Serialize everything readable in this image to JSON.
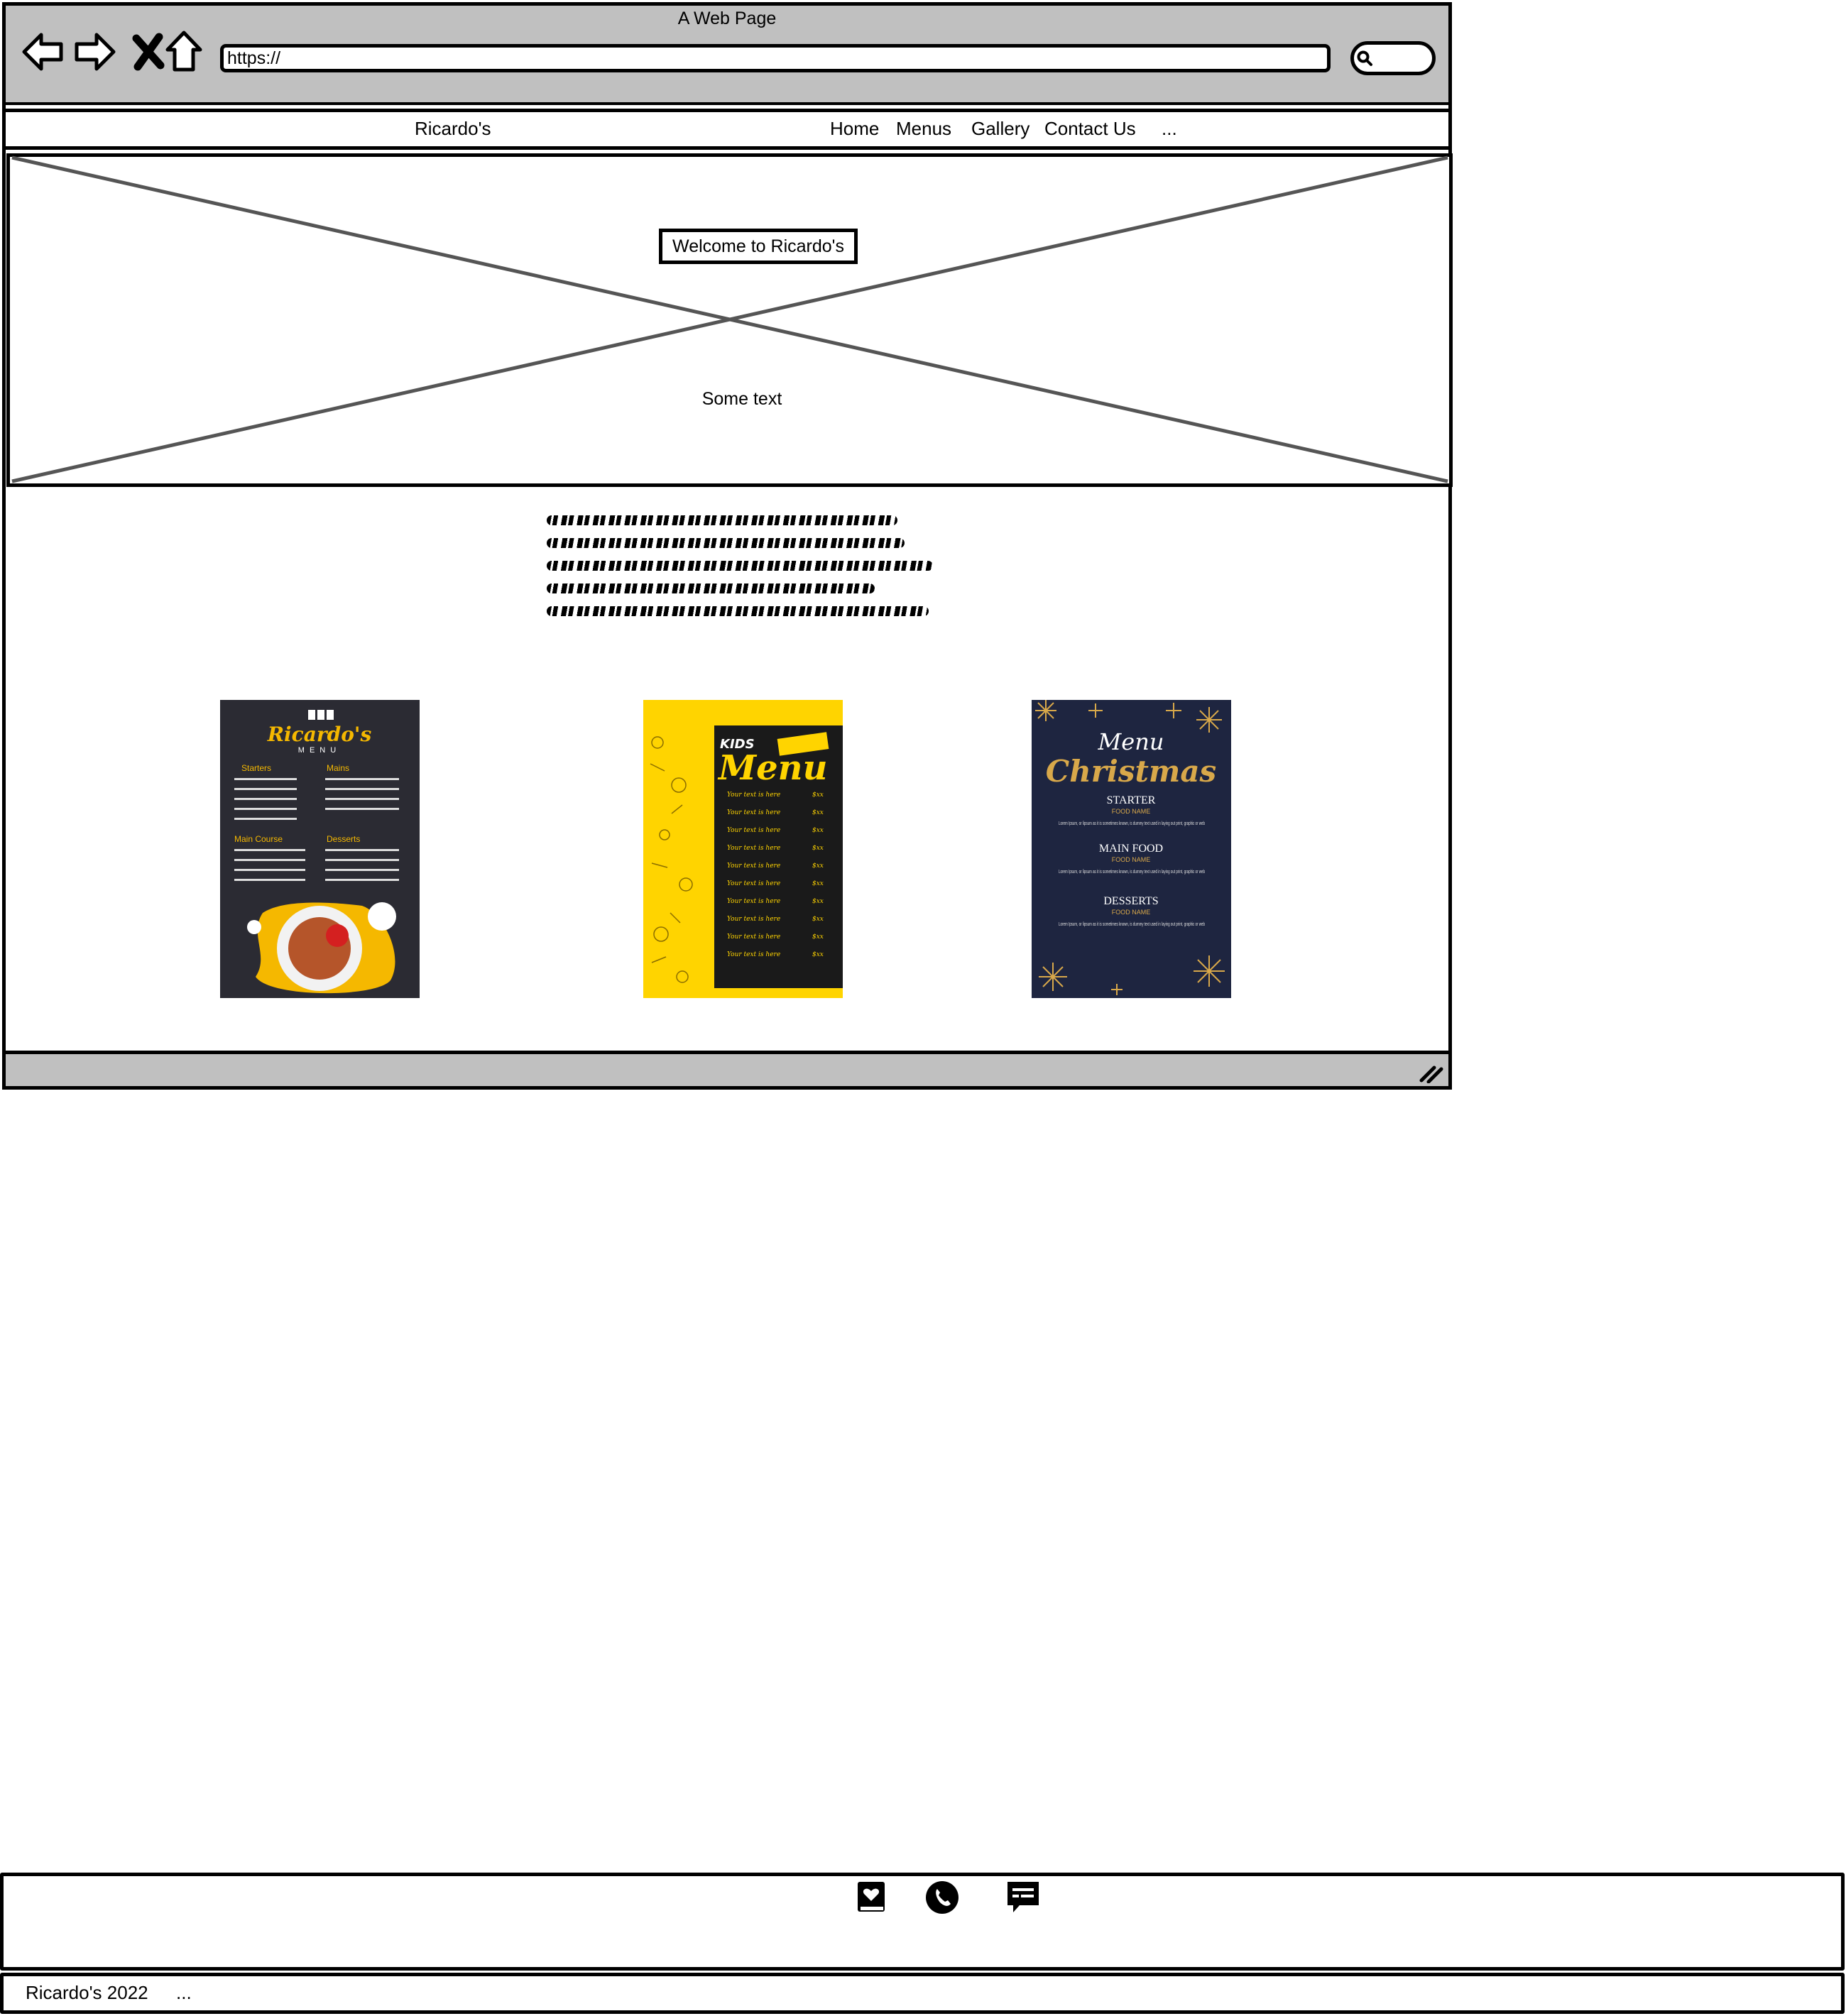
{
  "browser": {
    "title": "A Web Page",
    "url": "https://",
    "icons": [
      "back-arrow-icon",
      "forward-arrow-icon",
      "close-icon",
      "home-icon",
      "search-icon"
    ]
  },
  "nav": {
    "brand": "Ricardo's",
    "links": [
      "Home",
      "Menus",
      "Gallery",
      "Contact Us",
      "..."
    ]
  },
  "hero": {
    "title": "Welcome to Ricardo's",
    "subtitle": "Some text"
  },
  "menus": [
    {
      "name": "main-menu",
      "brand": "Ricardo's",
      "caption": "MENU",
      "sections": [
        "Starters",
        "Mains",
        "Main Course",
        "Desserts"
      ],
      "accent": "#f5b800",
      "background": "#2b2b33"
    },
    {
      "name": "kids-menu",
      "kicker": "KIDS",
      "title": "Menu",
      "line_text": "Your text is here",
      "line_price": "$xx",
      "accent": "#ffd400",
      "background": "#1a1a1a"
    },
    {
      "name": "christmas-menu",
      "kicker": "Menu",
      "title": "Christmas",
      "sections": [
        "STARTER",
        "MAIN FOOD",
        "DESSERTS"
      ],
      "item_label": "FOOD NAME",
      "body": "Lorem Ipsum, or lipsum as it is sometimes known, is dummy text used in laying out print, graphic or web",
      "accent": "#d8a84a",
      "background": "#1e2540"
    }
  ],
  "footer": {
    "icons": [
      "book-heart-icon",
      "phone-icon",
      "chat-icon"
    ],
    "copyright": "Ricardo's 2022",
    "ellipsis": "..."
  },
  "colors": {
    "chrome": "#c0c0c0",
    "border": "#000000",
    "placeholder_cross": "#555555"
  }
}
